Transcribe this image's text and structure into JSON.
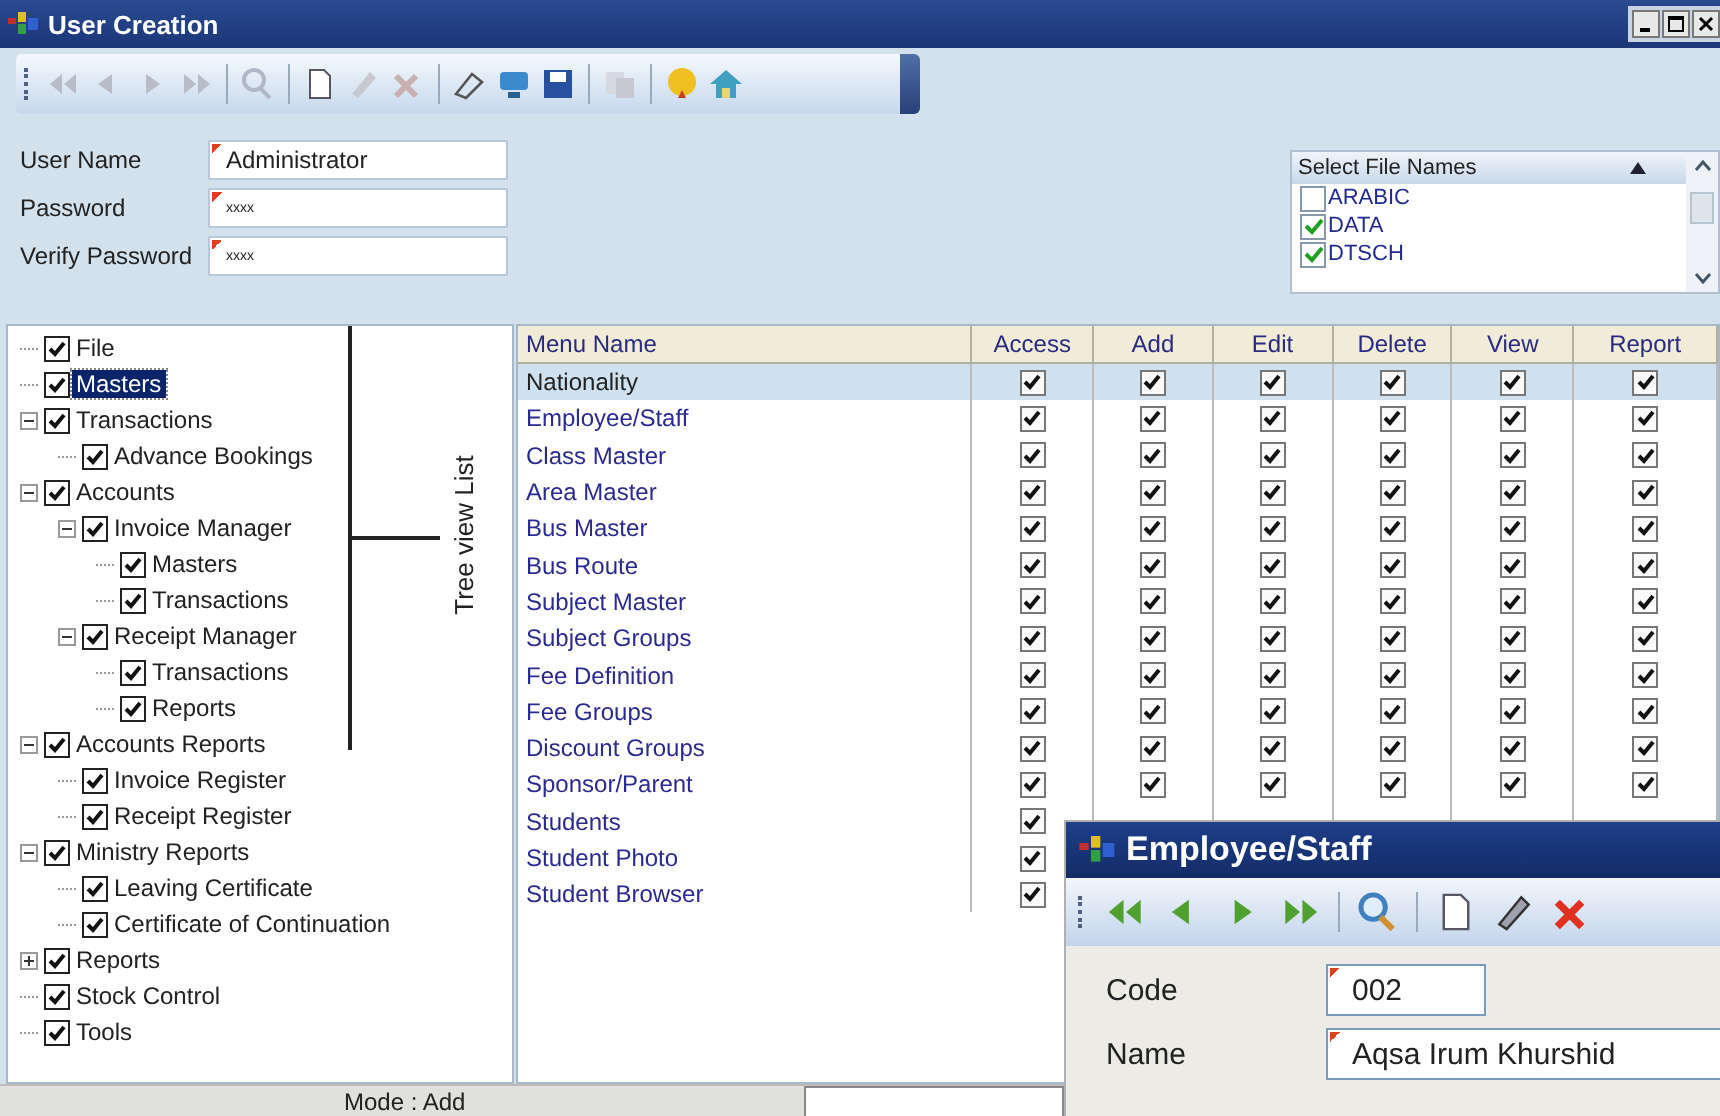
{
  "window": {
    "title": "User Creation"
  },
  "form": {
    "fields": [
      {
        "label": "User Name",
        "value": "Administrator",
        "kind": "text"
      },
      {
        "label": "Password",
        "value": "xxxx",
        "kind": "secret"
      },
      {
        "label": "Verify Password",
        "value": "xxxx",
        "kind": "secret"
      }
    ]
  },
  "file_list": {
    "header": "Select File Names",
    "items": [
      {
        "name": "ARABIC",
        "checked": false
      },
      {
        "name": "DATA",
        "checked": true
      },
      {
        "name": "DTSCH",
        "checked": true
      }
    ]
  },
  "tree": [
    {
      "label": "File",
      "checked": true,
      "selected": false
    },
    {
      "label": "Masters",
      "checked": true,
      "selected": true
    },
    {
      "label": "Transactions",
      "checked": true,
      "selected": false,
      "expanded": true,
      "children": [
        {
          "label": "Advance Bookings",
          "checked": true,
          "selected": false
        }
      ]
    },
    {
      "label": "Accounts",
      "checked": true,
      "selected": false,
      "expanded": true,
      "children": [
        {
          "label": "Invoice Manager",
          "checked": true,
          "selected": false,
          "expanded": true,
          "children": [
            {
              "label": "Masters",
              "checked": true,
              "selected": false
            },
            {
              "label": "Transactions",
              "checked": true,
              "selected": false
            }
          ]
        },
        {
          "label": "Receipt Manager",
          "checked": true,
          "selected": false,
          "expanded": true,
          "children": [
            {
              "label": "Transactions",
              "checked": true,
              "selected": false
            },
            {
              "label": "Reports",
              "checked": true,
              "selected": false
            }
          ]
        }
      ]
    },
    {
      "label": "Accounts Reports",
      "checked": true,
      "selected": false,
      "expanded": true,
      "children": [
        {
          "label": "Invoice Register",
          "checked": true,
          "selected": false
        },
        {
          "label": "Receipt Register",
          "checked": true,
          "selected": false
        }
      ]
    },
    {
      "label": "Ministry Reports",
      "checked": true,
      "selected": false,
      "expanded": true,
      "children": [
        {
          "label": "Leaving Certificate",
          "checked": true,
          "selected": false
        },
        {
          "label": "Certificate of Continuation",
          "checked": true,
          "selected": false
        }
      ]
    },
    {
      "label": "Reports",
      "checked": true,
      "selected": false,
      "expanded": false
    },
    {
      "label": "Stock Control",
      "checked": true,
      "selected": false
    },
    {
      "label": "Tools",
      "checked": true,
      "selected": false
    }
  ],
  "annotation": {
    "text": "Tree view List"
  },
  "grid": {
    "columns": [
      "Menu Name",
      "Access",
      "Add",
      "Edit",
      "Delete",
      "View",
      "Report"
    ],
    "rows": [
      {
        "name": "Nationality",
        "selected": true,
        "perms": [
          true,
          true,
          true,
          true,
          true,
          true
        ]
      },
      {
        "name": "Employee/Staff",
        "selected": false,
        "perms": [
          true,
          true,
          true,
          true,
          true,
          true
        ]
      },
      {
        "name": "Class Master",
        "selected": false,
        "perms": [
          true,
          true,
          true,
          true,
          true,
          true
        ]
      },
      {
        "name": "Area Master",
        "selected": false,
        "perms": [
          true,
          true,
          true,
          true,
          true,
          true
        ]
      },
      {
        "name": "Bus Master",
        "selected": false,
        "perms": [
          true,
          true,
          true,
          true,
          true,
          true
        ]
      },
      {
        "name": "Bus Route",
        "selected": false,
        "perms": [
          true,
          true,
          true,
          true,
          true,
          true
        ]
      },
      {
        "name": "Subject Master",
        "selected": false,
        "perms": [
          true,
          true,
          true,
          true,
          true,
          true
        ]
      },
      {
        "name": "Subject Groups",
        "selected": false,
        "perms": [
          true,
          true,
          true,
          true,
          true,
          true
        ]
      },
      {
        "name": "Fee Definition",
        "selected": false,
        "perms": [
          true,
          true,
          true,
          true,
          true,
          true
        ]
      },
      {
        "name": "Fee Groups",
        "selected": false,
        "perms": [
          true,
          true,
          true,
          true,
          true,
          true
        ]
      },
      {
        "name": "Discount Groups",
        "selected": false,
        "perms": [
          true,
          true,
          true,
          true,
          true,
          true
        ]
      },
      {
        "name": "Sponsor/Parent",
        "selected": false,
        "perms": [
          true,
          true,
          true,
          true,
          true,
          true
        ]
      },
      {
        "name": "Students",
        "selected": false,
        "perms": [
          true
        ]
      },
      {
        "name": "Student Photo",
        "selected": false,
        "perms": [
          true
        ]
      },
      {
        "name": "Student Browser",
        "selected": false,
        "perms": [
          true
        ]
      }
    ]
  },
  "status_bar": {
    "mode": "Mode : Add"
  },
  "popup": {
    "title": "Employee/Staff",
    "fields": [
      {
        "label": "Code",
        "value": "002"
      },
      {
        "label": "Name",
        "value": "Aqsa Irum Khurshid"
      }
    ]
  }
}
